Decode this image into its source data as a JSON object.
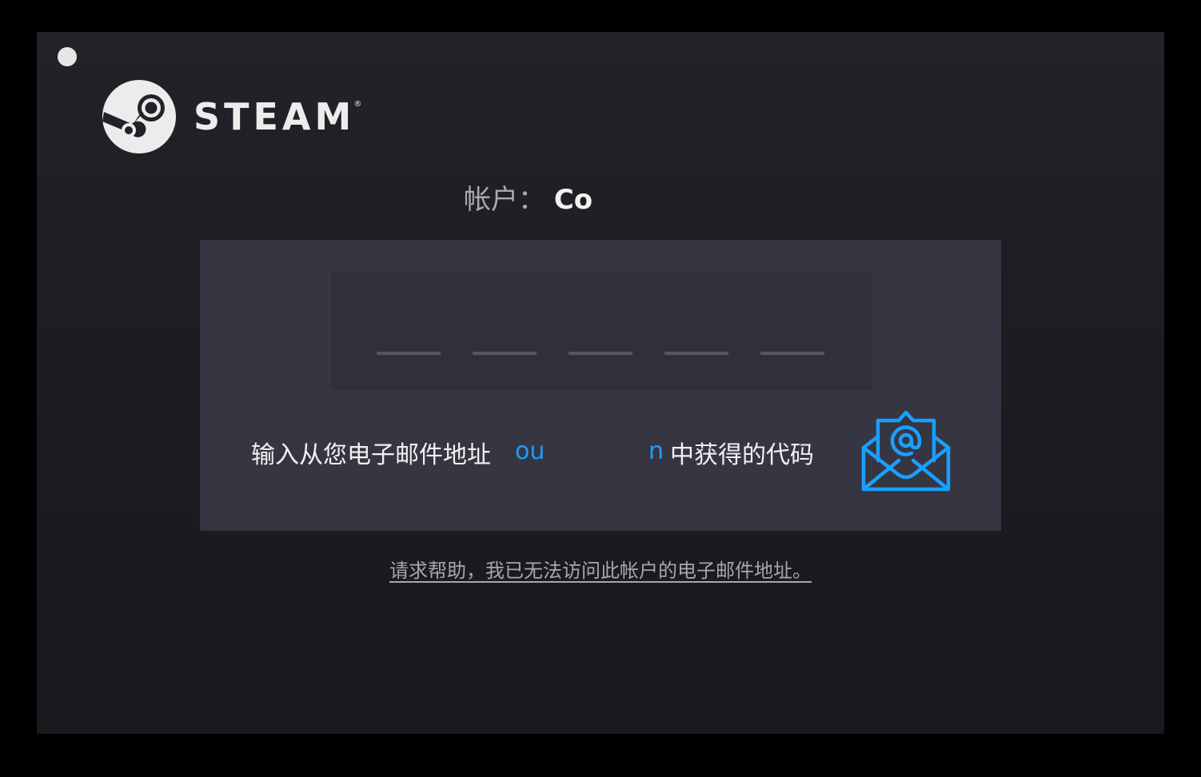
{
  "window": {
    "close_button": "close",
    "brand": {
      "name": "STEAM",
      "registered_mark": "®",
      "icon": "steam-logo-icon"
    }
  },
  "account": {
    "label": "帐户：",
    "value": "Co"
  },
  "code_entry": {
    "slot_count": 5,
    "instruction_before": "输入从您电子邮件地址",
    "email_part_a": "ou",
    "email_part_b": "n",
    "instruction_after": "中获得的代码",
    "icon": "open-envelope-at-icon"
  },
  "help_link": "请求帮助，我已无法访问此帐户的电子邮件地址。",
  "colors": {
    "accent": "#1a9fff",
    "window_bg": "#1e1f24",
    "panel_bg": "#353642",
    "code_box_bg": "#2f3039"
  }
}
